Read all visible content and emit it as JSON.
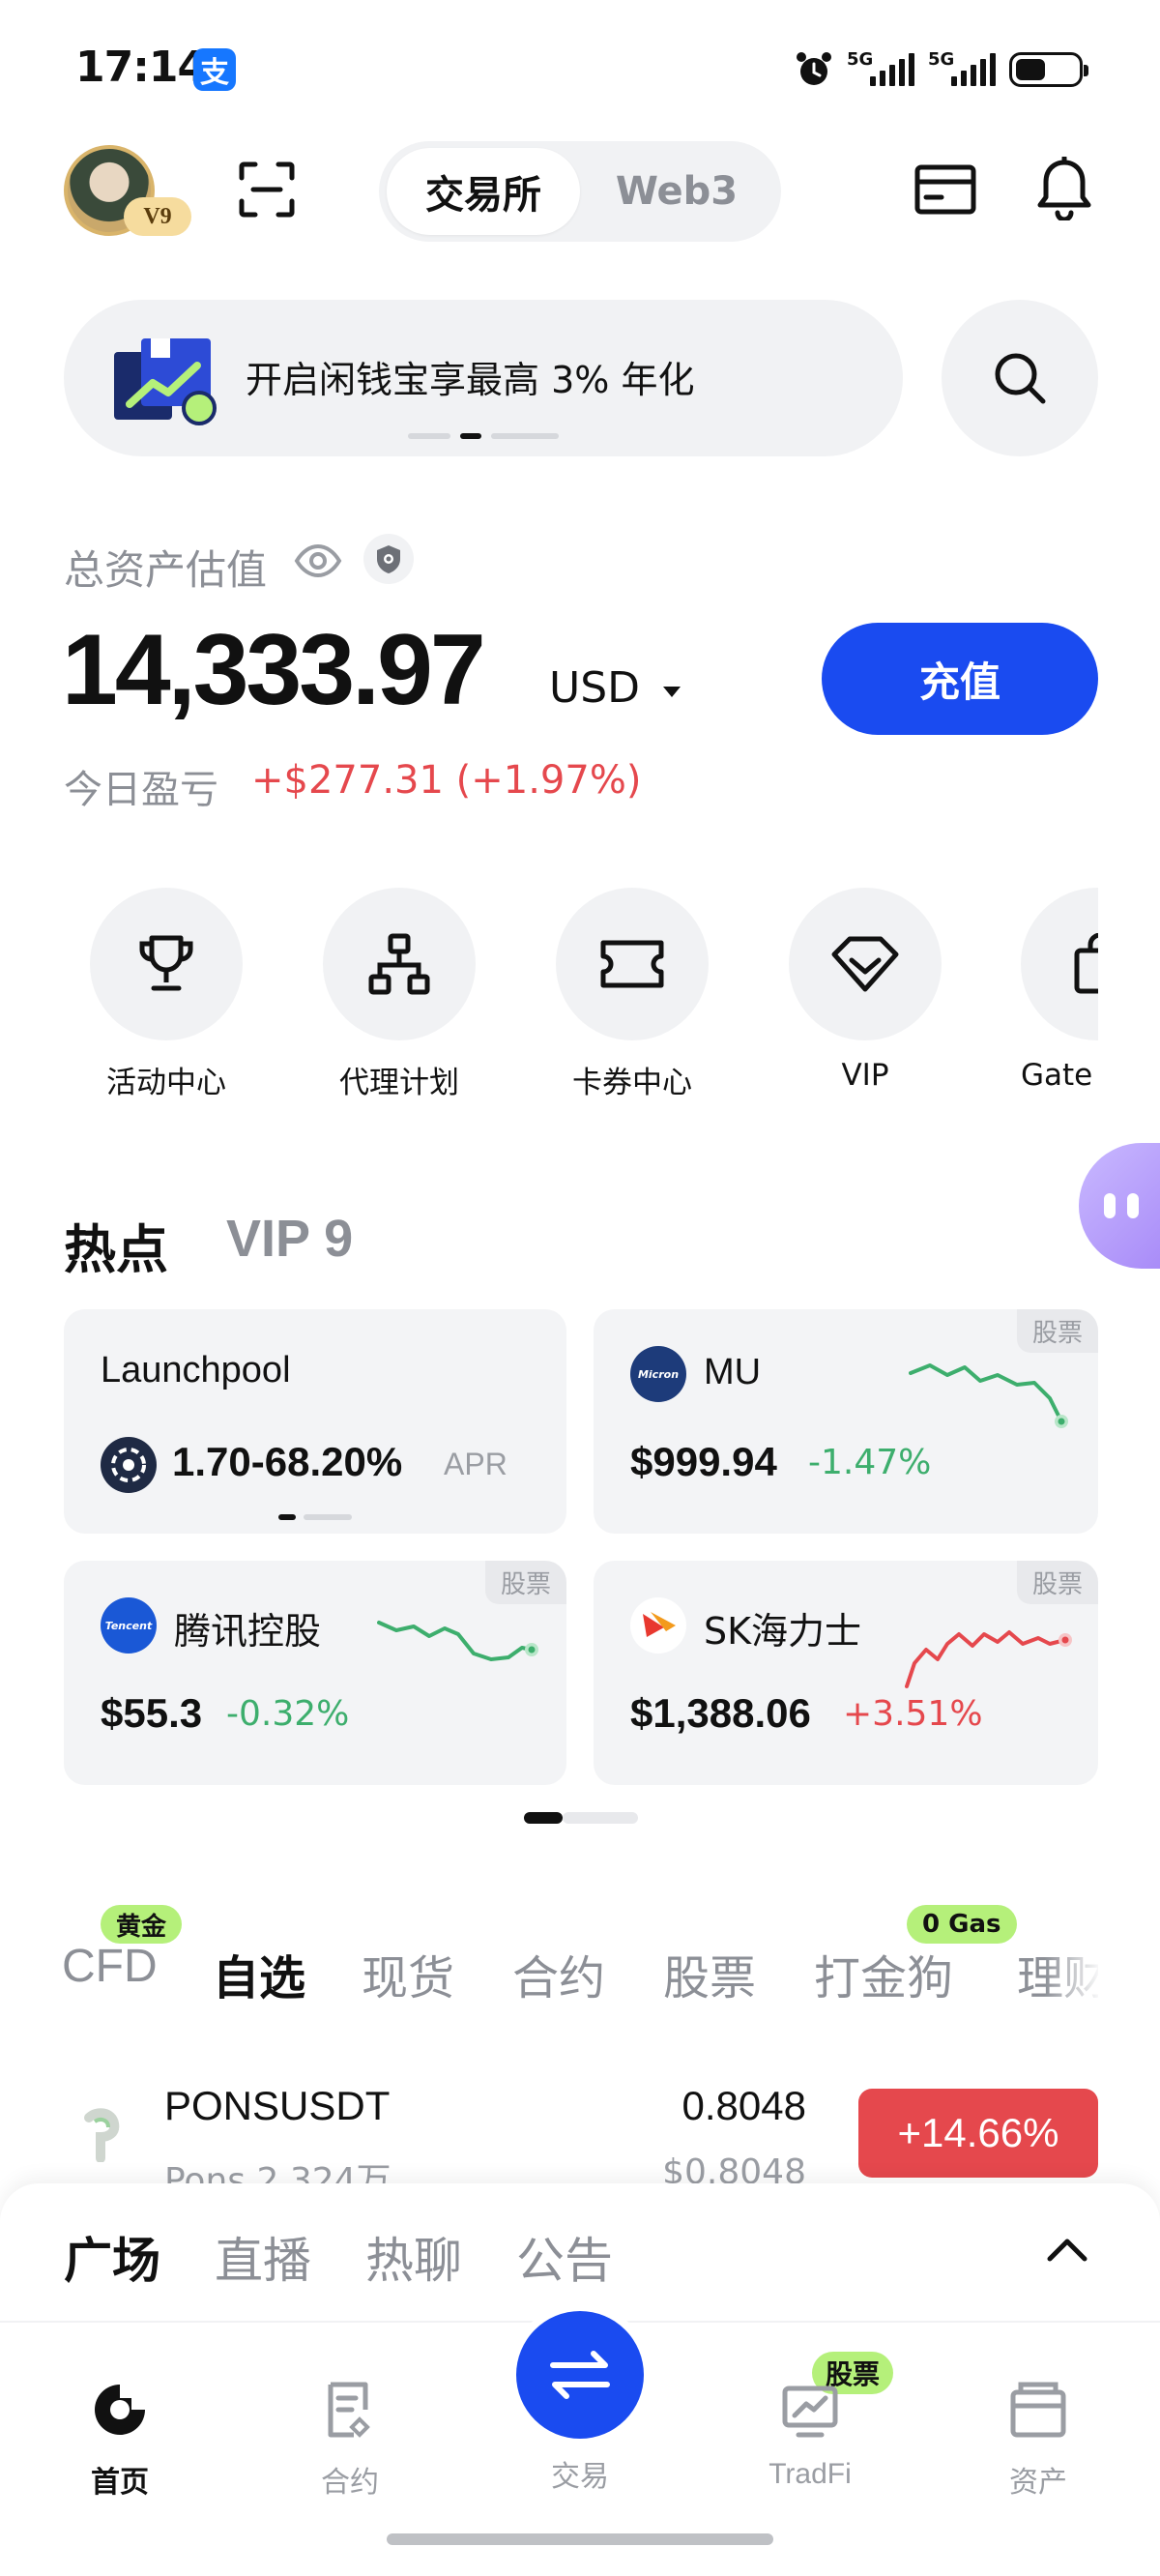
{
  "status_bar": {
    "time": "17:14",
    "alipay_glyph": "支",
    "signal1_label": "5G",
    "signal2_label": "5G"
  },
  "header": {
    "vip_badge": "V9",
    "segment": {
      "active": "交易所",
      "inactive": "Web3"
    }
  },
  "banner": {
    "text": "开启闲钱宝享最高 3% 年化"
  },
  "assets": {
    "label": "总资产估值",
    "total": "14,333.97",
    "currency": "USD",
    "deposit_label": "充值",
    "pnl_label": "今日盈亏",
    "pnl_value": "+$277.31 (+1.97%)"
  },
  "quick_actions": [
    {
      "label": "活动中心",
      "icon": "trophy-icon"
    },
    {
      "label": "代理计划",
      "icon": "hierarchy-icon"
    },
    {
      "label": "卡券中心",
      "icon": "ticket-icon"
    },
    {
      "label": "VIP",
      "icon": "diamond-icon"
    },
    {
      "label": "Gate",
      "icon": "bag-icon"
    }
  ],
  "hot": {
    "title": "热点",
    "vip_title": "VIP 9",
    "cards": [
      {
        "name": "Launchpool",
        "value": "1.70-68.20%",
        "unit": "APR"
      },
      {
        "tag": "股票",
        "logo": "Micron",
        "name": "MU",
        "price": "$999.94",
        "change": "-1.47%",
        "trend": "down"
      },
      {
        "tag": "股票",
        "logo": "Tencent",
        "name": "腾讯控股",
        "price": "$55.3",
        "change": "-0.32%",
        "trend": "down"
      },
      {
        "tag": "股票",
        "name": "SK海力士",
        "price": "$1,388.06",
        "change": "+3.51%",
        "trend": "up"
      }
    ]
  },
  "market_tabs": {
    "tabs": [
      "CFD",
      "自选",
      "现货",
      "合约",
      "股票",
      "打金狗",
      "理财"
    ],
    "active_index": 1,
    "pill_cfd": "黄金",
    "pill_dajingou": "0 Gas"
  },
  "list": [
    {
      "symbol": "PONSUSDT",
      "sub": "Pons 2,324万",
      "price": "0.8048",
      "fiat": "$0.8048",
      "change": "+14.66%"
    }
  ],
  "sheet": {
    "tabs": [
      "广场",
      "直播",
      "热聊",
      "公告"
    ]
  },
  "nav": {
    "items": [
      "首页",
      "合约",
      "交易",
      "TradFi",
      "资产"
    ],
    "tradfi_pill": "股票"
  },
  "colors": {
    "accent": "#1a4bf0",
    "up": "#e5484d",
    "down": "#3dae6d",
    "pill": "#b5f07a"
  }
}
